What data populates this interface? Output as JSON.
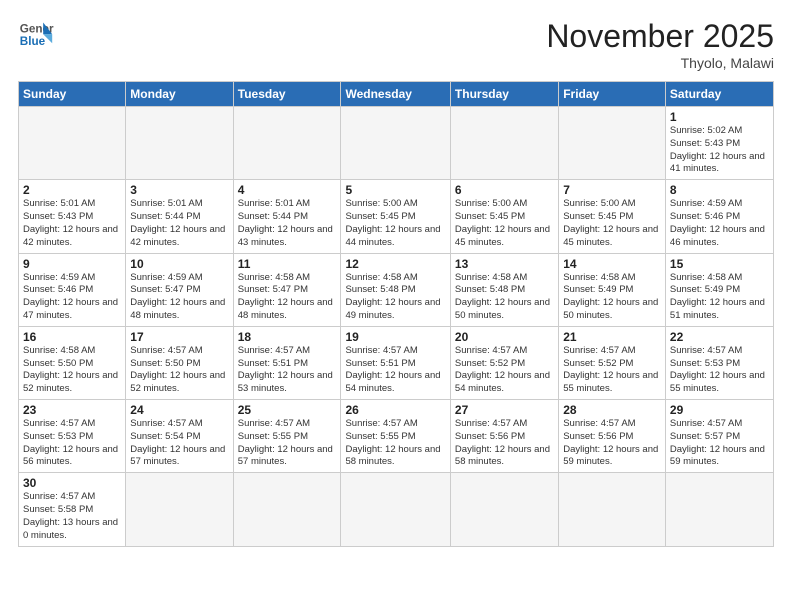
{
  "header": {
    "logo_general": "General",
    "logo_blue": "Blue",
    "month_title": "November 2025",
    "location": "Thyolo, Malawi"
  },
  "weekdays": [
    "Sunday",
    "Monday",
    "Tuesday",
    "Wednesday",
    "Thursday",
    "Friday",
    "Saturday"
  ],
  "weeks": [
    [
      {
        "day": "",
        "info": ""
      },
      {
        "day": "",
        "info": ""
      },
      {
        "day": "",
        "info": ""
      },
      {
        "day": "",
        "info": ""
      },
      {
        "day": "",
        "info": ""
      },
      {
        "day": "",
        "info": ""
      },
      {
        "day": "1",
        "info": "Sunrise: 5:02 AM\nSunset: 5:43 PM\nDaylight: 12 hours\nand 41 minutes."
      }
    ],
    [
      {
        "day": "2",
        "info": "Sunrise: 5:01 AM\nSunset: 5:43 PM\nDaylight: 12 hours\nand 42 minutes."
      },
      {
        "day": "3",
        "info": "Sunrise: 5:01 AM\nSunset: 5:44 PM\nDaylight: 12 hours\nand 42 minutes."
      },
      {
        "day": "4",
        "info": "Sunrise: 5:01 AM\nSunset: 5:44 PM\nDaylight: 12 hours\nand 43 minutes."
      },
      {
        "day": "5",
        "info": "Sunrise: 5:00 AM\nSunset: 5:45 PM\nDaylight: 12 hours\nand 44 minutes."
      },
      {
        "day": "6",
        "info": "Sunrise: 5:00 AM\nSunset: 5:45 PM\nDaylight: 12 hours\nand 45 minutes."
      },
      {
        "day": "7",
        "info": "Sunrise: 5:00 AM\nSunset: 5:45 PM\nDaylight: 12 hours\nand 45 minutes."
      },
      {
        "day": "8",
        "info": "Sunrise: 4:59 AM\nSunset: 5:46 PM\nDaylight: 12 hours\nand 46 minutes."
      }
    ],
    [
      {
        "day": "9",
        "info": "Sunrise: 4:59 AM\nSunset: 5:46 PM\nDaylight: 12 hours\nand 47 minutes."
      },
      {
        "day": "10",
        "info": "Sunrise: 4:59 AM\nSunset: 5:47 PM\nDaylight: 12 hours\nand 48 minutes."
      },
      {
        "day": "11",
        "info": "Sunrise: 4:58 AM\nSunset: 5:47 PM\nDaylight: 12 hours\nand 48 minutes."
      },
      {
        "day": "12",
        "info": "Sunrise: 4:58 AM\nSunset: 5:48 PM\nDaylight: 12 hours\nand 49 minutes."
      },
      {
        "day": "13",
        "info": "Sunrise: 4:58 AM\nSunset: 5:48 PM\nDaylight: 12 hours\nand 50 minutes."
      },
      {
        "day": "14",
        "info": "Sunrise: 4:58 AM\nSunset: 5:49 PM\nDaylight: 12 hours\nand 50 minutes."
      },
      {
        "day": "15",
        "info": "Sunrise: 4:58 AM\nSunset: 5:49 PM\nDaylight: 12 hours\nand 51 minutes."
      }
    ],
    [
      {
        "day": "16",
        "info": "Sunrise: 4:58 AM\nSunset: 5:50 PM\nDaylight: 12 hours\nand 52 minutes."
      },
      {
        "day": "17",
        "info": "Sunrise: 4:57 AM\nSunset: 5:50 PM\nDaylight: 12 hours\nand 52 minutes."
      },
      {
        "day": "18",
        "info": "Sunrise: 4:57 AM\nSunset: 5:51 PM\nDaylight: 12 hours\nand 53 minutes."
      },
      {
        "day": "19",
        "info": "Sunrise: 4:57 AM\nSunset: 5:51 PM\nDaylight: 12 hours\nand 54 minutes."
      },
      {
        "day": "20",
        "info": "Sunrise: 4:57 AM\nSunset: 5:52 PM\nDaylight: 12 hours\nand 54 minutes."
      },
      {
        "day": "21",
        "info": "Sunrise: 4:57 AM\nSunset: 5:52 PM\nDaylight: 12 hours\nand 55 minutes."
      },
      {
        "day": "22",
        "info": "Sunrise: 4:57 AM\nSunset: 5:53 PM\nDaylight: 12 hours\nand 55 minutes."
      }
    ],
    [
      {
        "day": "23",
        "info": "Sunrise: 4:57 AM\nSunset: 5:53 PM\nDaylight: 12 hours\nand 56 minutes."
      },
      {
        "day": "24",
        "info": "Sunrise: 4:57 AM\nSunset: 5:54 PM\nDaylight: 12 hours\nand 57 minutes."
      },
      {
        "day": "25",
        "info": "Sunrise: 4:57 AM\nSunset: 5:55 PM\nDaylight: 12 hours\nand 57 minutes."
      },
      {
        "day": "26",
        "info": "Sunrise: 4:57 AM\nSunset: 5:55 PM\nDaylight: 12 hours\nand 58 minutes."
      },
      {
        "day": "27",
        "info": "Sunrise: 4:57 AM\nSunset: 5:56 PM\nDaylight: 12 hours\nand 58 minutes."
      },
      {
        "day": "28",
        "info": "Sunrise: 4:57 AM\nSunset: 5:56 PM\nDaylight: 12 hours\nand 59 minutes."
      },
      {
        "day": "29",
        "info": "Sunrise: 4:57 AM\nSunset: 5:57 PM\nDaylight: 12 hours\nand 59 minutes."
      }
    ],
    [
      {
        "day": "30",
        "info": "Sunrise: 4:57 AM\nSunset: 5:58 PM\nDaylight: 13 hours\nand 0 minutes."
      },
      {
        "day": "",
        "info": ""
      },
      {
        "day": "",
        "info": ""
      },
      {
        "day": "",
        "info": ""
      },
      {
        "day": "",
        "info": ""
      },
      {
        "day": "",
        "info": ""
      },
      {
        "day": "",
        "info": ""
      }
    ]
  ]
}
